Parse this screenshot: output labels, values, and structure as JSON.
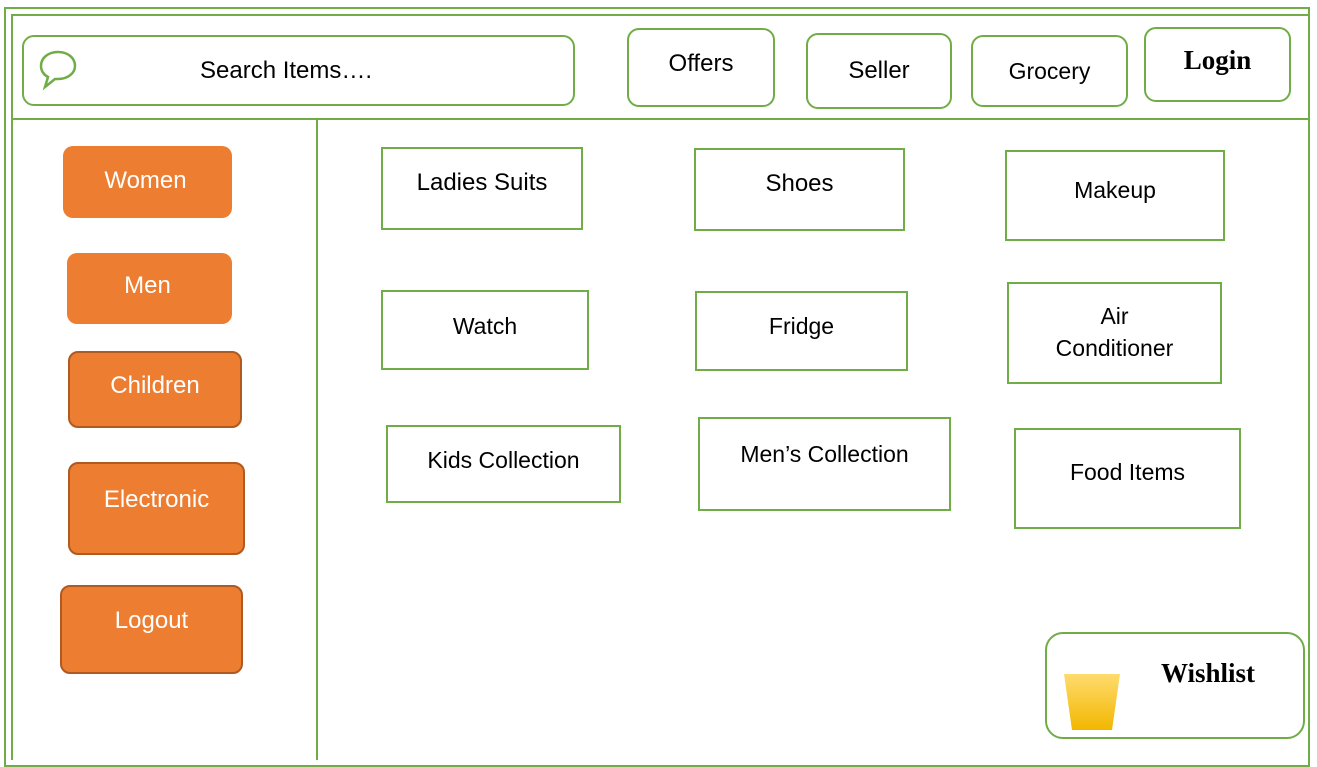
{
  "header": {
    "search_placeholder": "Search Items….",
    "search_icon": "speech-bubble-icon",
    "nav": {
      "offers": "Offers",
      "seller": "Seller",
      "grocery": "Grocery",
      "login": "Login"
    }
  },
  "sidebar": {
    "items": [
      {
        "label": "Women"
      },
      {
        "label": "Men"
      },
      {
        "label": "Children"
      },
      {
        "label": "Electronic"
      },
      {
        "label": "Logout"
      }
    ]
  },
  "categories": [
    {
      "label": "Ladies Suits"
    },
    {
      "label": "Shoes"
    },
    {
      "label": "Makeup"
    },
    {
      "label": "Watch"
    },
    {
      "label": "Fridge"
    },
    {
      "label": "Air Conditioner"
    },
    {
      "label": "Kids Collection"
    },
    {
      "label": "Men’s Collection"
    },
    {
      "label": "Food Items"
    }
  ],
  "wishlist": {
    "label": "Wishlist",
    "icon": "cup-icon"
  },
  "colors": {
    "border_green": "#70ad47",
    "sidebar_orange": "#ed7d31",
    "cup_yellow": "#ffc000"
  }
}
